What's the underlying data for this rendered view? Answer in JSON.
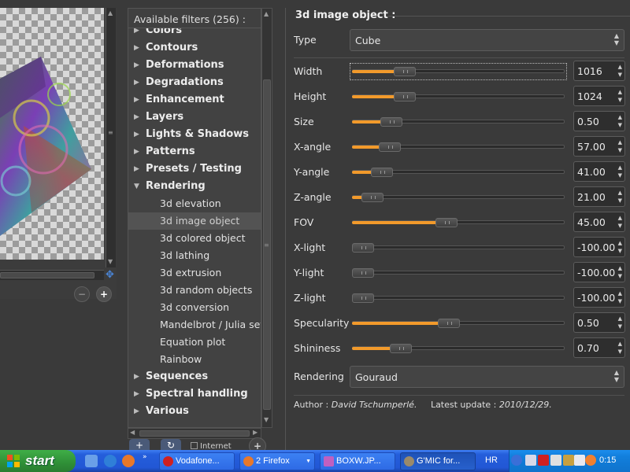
{
  "filters": {
    "header": "Available filters (256) :",
    "categories": [
      {
        "label": "Colors"
      },
      {
        "label": "Contours"
      },
      {
        "label": "Deformations"
      },
      {
        "label": "Degradations"
      },
      {
        "label": "Enhancement"
      },
      {
        "label": "Layers"
      },
      {
        "label": "Lights & Shadows"
      },
      {
        "label": "Patterns"
      },
      {
        "label": "Presets / Testing"
      },
      {
        "label": "Rendering"
      }
    ],
    "rendering_items": [
      "3d elevation",
      "3d image object",
      "3d colored object",
      "3d lathing",
      "3d extrusion",
      "3d random objects",
      "3d conversion",
      "Mandelbrot / Julia sets",
      "Equation plot",
      "Rainbow"
    ],
    "selected": "3d image object",
    "more_categories": [
      {
        "label": "Sequences"
      },
      {
        "label": "Spectral handling"
      },
      {
        "label": "Various"
      }
    ],
    "internet_label": "Internet"
  },
  "params": {
    "title": "3d image object :",
    "type": {
      "label": "Type",
      "value": "Cube"
    },
    "sliders": [
      {
        "label": "Width",
        "value": "1016",
        "level": 0.22
      },
      {
        "label": "Height",
        "value": "1024",
        "level": 0.22
      },
      {
        "label": "Size",
        "value": "0.50",
        "level": 0.15
      },
      {
        "label": "X-angle",
        "value": "57.00",
        "level": 0.14
      },
      {
        "label": "Y-angle",
        "value": "41.00",
        "level": 0.1
      },
      {
        "label": "Z-angle",
        "value": "21.00",
        "level": 0.05
      },
      {
        "label": "FOV",
        "value": "45.00",
        "level": 0.44
      },
      {
        "label": "X-light",
        "value": "-100.00",
        "level": 0.0
      },
      {
        "label": "Y-light",
        "value": "-100.00",
        "level": 0.0
      },
      {
        "label": "Z-light",
        "value": "-100.00",
        "level": 0.0
      },
      {
        "label": "Specularity",
        "value": "0.50",
        "level": 0.45
      },
      {
        "label": "Shininess",
        "value": "0.70",
        "level": 0.2
      }
    ],
    "rendering": {
      "label": "Rendering",
      "value": "Gouraud"
    },
    "author_label": "Author :",
    "author_name": "David Tschumperlé.",
    "update_label": "Latest update :",
    "update_date": "2010/12/29."
  },
  "taskbar": {
    "start": "start",
    "tasks": [
      {
        "label": "Vodafone...",
        "icon": "opera-icon"
      },
      {
        "label": "2 Firefox",
        "icon": "firefox-icon"
      },
      {
        "label": "BOXW.JP...",
        "icon": "image-icon"
      },
      {
        "label": "G'MIC for...",
        "icon": "gimp-icon"
      }
    ],
    "lang": "HR",
    "clock": "0:15"
  }
}
